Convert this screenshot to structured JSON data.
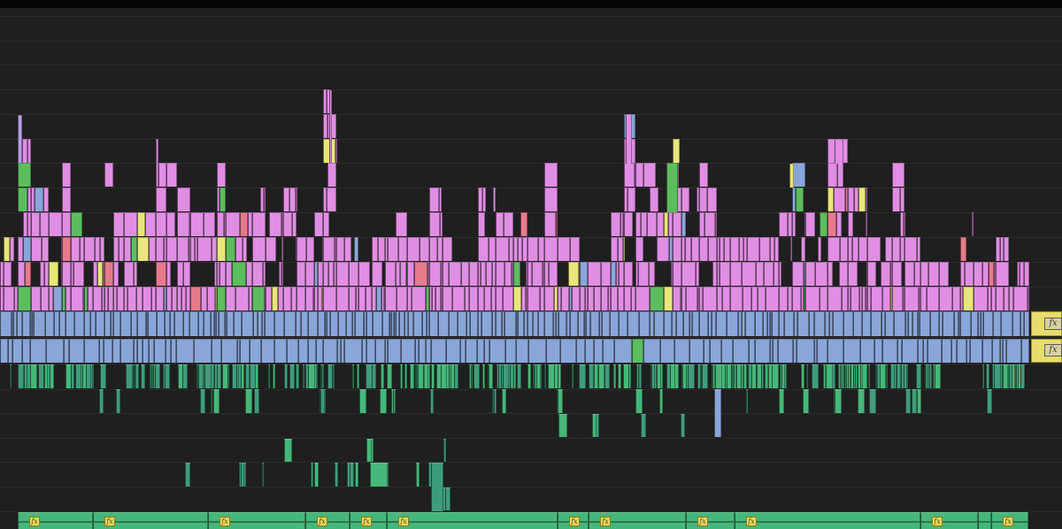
{
  "timeline": {
    "fx_label": "fx",
    "clip_colors": {
      "violet": "#e08ee3",
      "green": "#5cbd5f",
      "yellow": "#e8e67a",
      "blue": "#8aa6d8",
      "red": "#e77a8c",
      "lavender": "#b8a0e8",
      "audio_teal": "#3f9c7b",
      "audio_green": "#46b77a",
      "adjustment_yellow": "#e7dd6d"
    },
    "track_count": 21
  }
}
